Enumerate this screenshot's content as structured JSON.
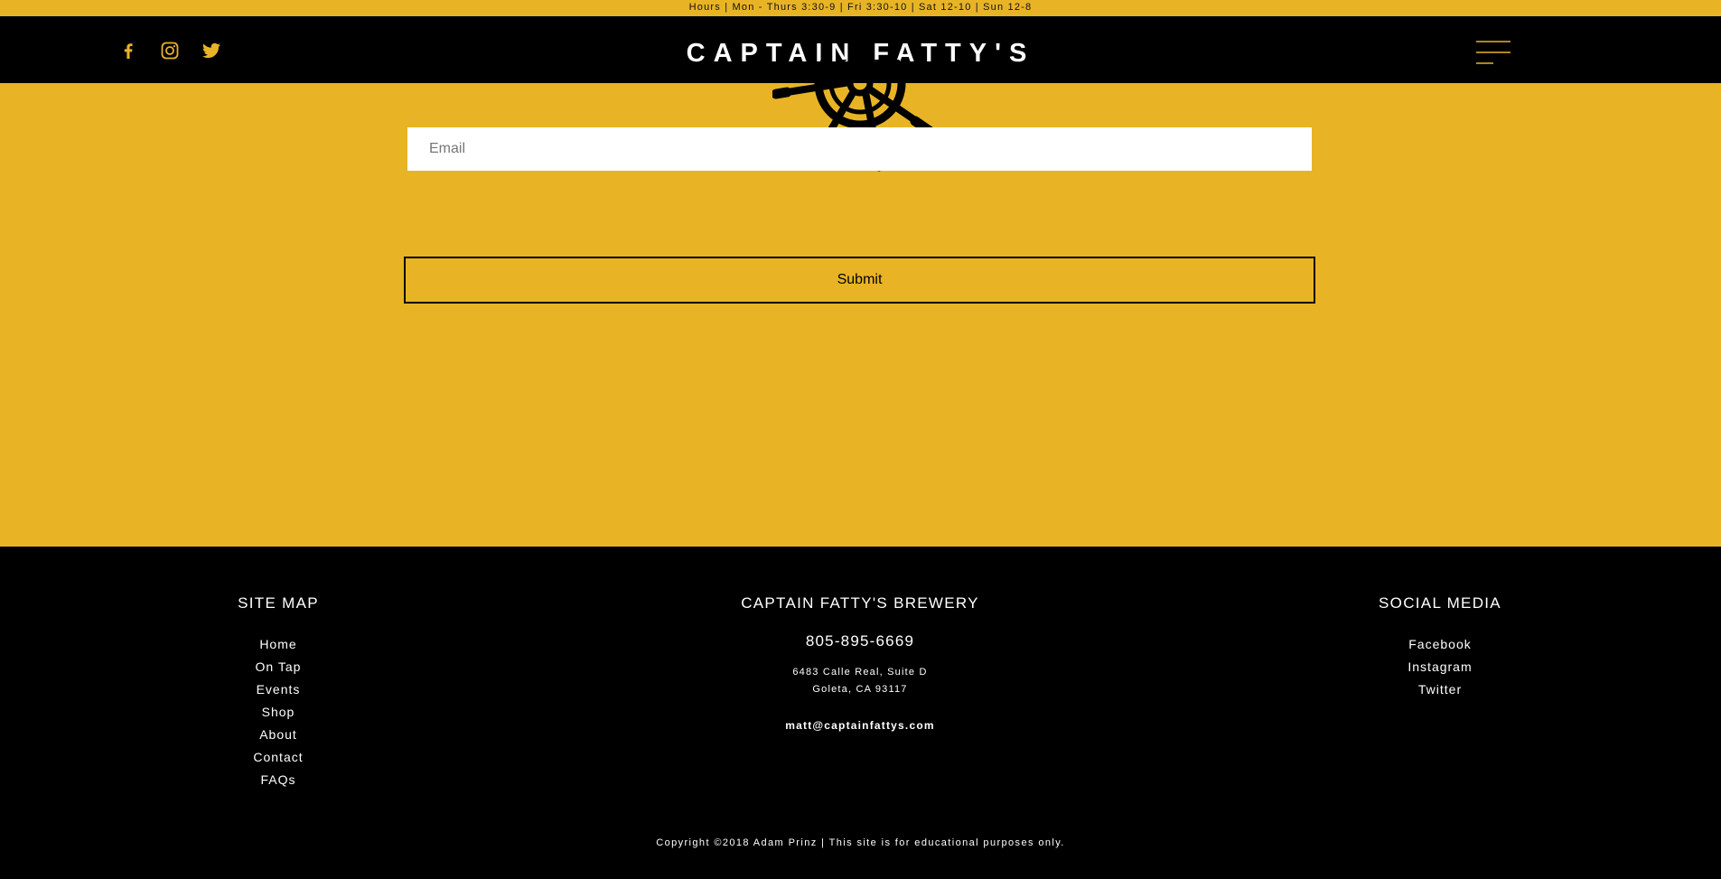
{
  "hours": "Hours | Mon - Thurs 3:30-9 | Fri 3:30-10 | Sat 12-10 | Sun 12-8",
  "header": {
    "brand": "CAPTAIN FATTY'S",
    "social_icons": [
      "facebook-icon",
      "instagram-icon",
      "twitter-icon"
    ],
    "menu_icon": "hamburger-menu-icon"
  },
  "form": {
    "email_placeholder": "Email",
    "submit_label": "Submit"
  },
  "footer": {
    "site_map": {
      "title": "SITE MAP",
      "links": [
        "Home",
        "On Tap",
        "Events",
        "Shop",
        "About",
        "Contact",
        "FAQs"
      ]
    },
    "brewery": {
      "title": "CAPTAIN FATTY'S BREWERY",
      "phone": "805-895-6669",
      "address_line1": "6483 Calle Real, Suite D",
      "address_line2": "Goleta, CA 93117",
      "email": "matt@captainfattys.com"
    },
    "social": {
      "title": "SOCIAL MEDIA",
      "links": [
        "Facebook",
        "Instagram",
        "Twitter"
      ]
    },
    "copyright": "Copyright ©2018 Adam Prinz | This site is for educational purposes only."
  },
  "colors": {
    "accent": "#e8b426",
    "dark": "#000000",
    "text_light": "#ffffff"
  }
}
